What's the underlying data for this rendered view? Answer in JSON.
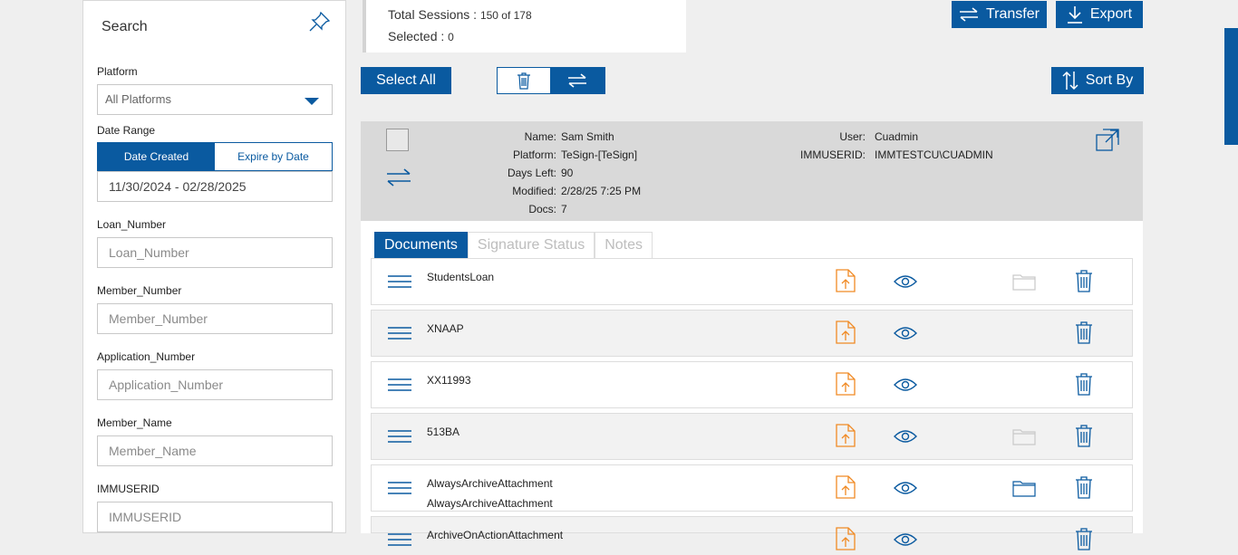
{
  "sidebar": {
    "title": "Search",
    "platform_label": "Platform",
    "platform_value": "All Platforms",
    "date_range_label": "Date Range",
    "date_tab_created": "Date Created",
    "date_tab_expire": "Expire by Date",
    "date_range_value": "11/30/2024 - 02/28/2025",
    "fields": [
      {
        "label": "Loan_Number",
        "placeholder": "Loan_Number"
      },
      {
        "label": "Member_Number",
        "placeholder": "Member_Number"
      },
      {
        "label": "Application_Number",
        "placeholder": "Application_Number"
      },
      {
        "label": "Member_Name",
        "placeholder": "Member_Name"
      },
      {
        "label": "IMMUSERID",
        "placeholder": "IMMUSERID"
      }
    ]
  },
  "summary": {
    "total_label": "Total Sessions : ",
    "total_value": "150 of 178",
    "selected_label": "Selected : ",
    "selected_value": "0"
  },
  "toolbar": {
    "transfer": "Transfer",
    "export": "Export",
    "select_all": "Select All",
    "sort_by": "Sort By"
  },
  "session": {
    "name_key": "Name:",
    "name": "Sam Smith",
    "platform_key": "Platform:",
    "platform": "TeSign-[TeSign]",
    "days_left_key": "Days Left:",
    "days_left": "90",
    "modified_key": "Modified:",
    "modified": "2/28/25 7:25 PM",
    "docs_key": "Docs:",
    "docs": "7",
    "user_key": "User:",
    "user": "Cuadmin",
    "immuserid_key": "IMMUSERID:",
    "immuserid": "IMMTESTCU\\CUADMIN"
  },
  "tabs": [
    "Documents",
    "Signature Status",
    "Notes"
  ],
  "documents": [
    {
      "line1": "StudentsLoan",
      "line2": ""
    },
    {
      "line1": "XNAAP",
      "line2": ""
    },
    {
      "line1": "XX11993",
      "line2": ""
    },
    {
      "line1": "513BA",
      "line2": ""
    },
    {
      "line1": "AlwaysArchiveAttachment",
      "line2": "AlwaysArchiveAttachment"
    },
    {
      "line1": "ArchiveOnActionAttachment",
      "line2": ""
    }
  ],
  "colors": {
    "primary": "#0a5aa0",
    "accent": "#f08a24",
    "header_gray": "#d9d9d9"
  }
}
